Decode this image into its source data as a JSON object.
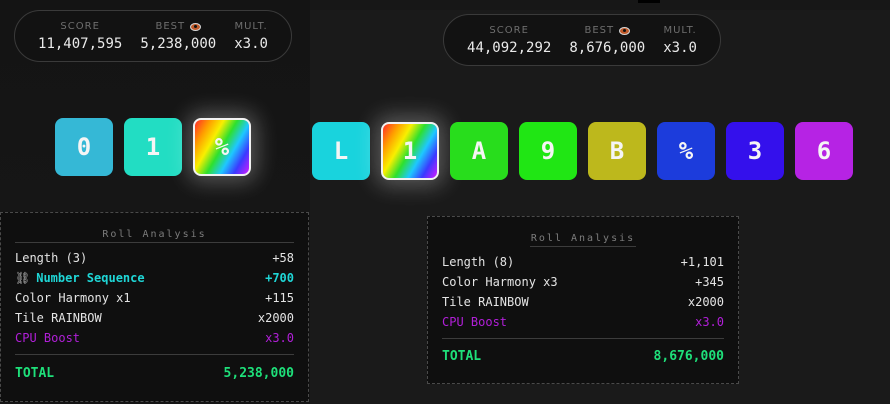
{
  "left": {
    "score": {
      "score_label": "SCORE",
      "score_value": "11,407,595",
      "best_label": "BEST",
      "best_value": "5,238,000",
      "mult_label": "MULT.",
      "mult_value": "x3.0",
      "best_icon": "eye-icon"
    },
    "tiles": [
      {
        "char": "0",
        "color": "#35b8d6"
      },
      {
        "char": "1",
        "color": "#22ddc3"
      },
      {
        "char": "%",
        "color": "rainbow"
      }
    ],
    "analysis": {
      "title": "Roll Analysis",
      "rows": [
        {
          "label": "Length (3)",
          "value": "+58"
        },
        {
          "label": "Number Sequence",
          "value": "+700",
          "icon": "chain-icon"
        },
        {
          "label": "Color Harmony x1",
          "value": "+115"
        },
        {
          "label": "Tile RAINBOW",
          "value": "x2000"
        },
        {
          "label": "CPU Boost",
          "value": "x3.0"
        }
      ],
      "total_label": "TOTAL",
      "total_value": "5,238,000"
    }
  },
  "right": {
    "score": {
      "score_label": "SCORE",
      "score_value": "44,092,292",
      "best_label": "BEST",
      "best_value": "8,676,000",
      "mult_label": "MULT.",
      "mult_value": "x3.0",
      "best_icon": "eye-icon"
    },
    "tiles": [
      {
        "char": "L",
        "color": "#19d3dd"
      },
      {
        "char": "1",
        "color": "rainbow"
      },
      {
        "char": "A",
        "color": "#28dd1c"
      },
      {
        "char": "9",
        "color": "#20e614"
      },
      {
        "char": "B",
        "color": "#bdb81c"
      },
      {
        "char": "%",
        "color": "#1c3cdc"
      },
      {
        "char": "3",
        "color": "#3410ec"
      },
      {
        "char": "6",
        "color": "#b623e4"
      }
    ],
    "analysis": {
      "title": "Roll Analysis",
      "rows": [
        {
          "label": "Length (8)",
          "value": "+1,101"
        },
        {
          "label": "Color Harmony x3",
          "value": "+345"
        },
        {
          "label": "Tile RAINBOW",
          "value": "x2000"
        },
        {
          "label": "CPU Boost",
          "value": "x3.0"
        }
      ],
      "total_label": "TOTAL",
      "total_value": "8,676,000"
    }
  },
  "colors": {
    "sequence": "#1fd6d6",
    "cpu_boost": "#b11fd8",
    "total": "#1ee07a"
  }
}
